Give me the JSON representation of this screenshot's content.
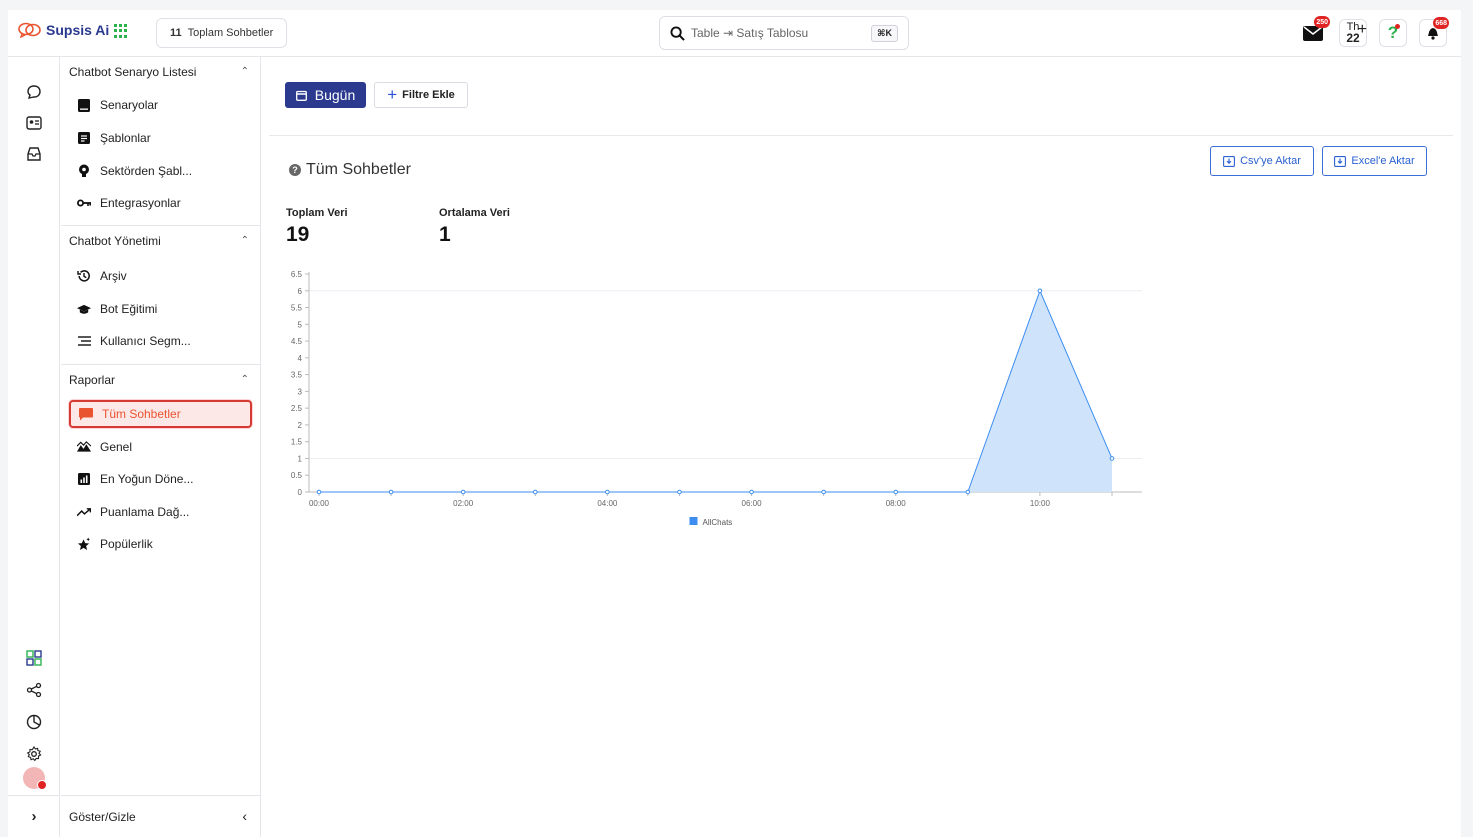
{
  "app": {
    "name": "Supsis Ai"
  },
  "header": {
    "page_tag_count": "11",
    "page_tag_label": "Toplam Sohbetler",
    "search_value": "Table ⇥ Satış Tablosu",
    "search_shortcut": "⌘K",
    "mail_badge": "250",
    "calendar_day_abbr": "Th",
    "calendar_day": "22",
    "notification_badge": "668",
    "colors": {
      "brand": "#2b3a8f",
      "accent_red": "#e02424",
      "link_blue": "#2b61d1"
    }
  },
  "sidebar": {
    "sections": [
      {
        "title": "Chatbot Senaryo Listesi",
        "items": [
          {
            "label": "Senaryolar",
            "icon": "book-icon"
          },
          {
            "label": "Şablonlar",
            "icon": "template-icon"
          },
          {
            "label": "Sektörden Şabl...",
            "icon": "bulb-icon"
          },
          {
            "label": "Entegrasyonlar",
            "icon": "key-icon"
          }
        ]
      },
      {
        "title": "Chatbot Yönetimi",
        "items": [
          {
            "label": "Arşiv",
            "icon": "history-icon"
          },
          {
            "label": "Bot Eğitimi",
            "icon": "graduation-cap-icon"
          },
          {
            "label": "Kullanıcı Segm...",
            "icon": "segment-lines-icon"
          }
        ]
      },
      {
        "title": "Raporlar",
        "items": [
          {
            "label": "Tüm Sohbetler",
            "icon": "chat-bubble-icon",
            "active": true
          },
          {
            "label": "Genel",
            "icon": "mountain-chart-icon"
          },
          {
            "label": "En Yoğun Döne...",
            "icon": "bar-chart-icon"
          },
          {
            "label": "Puanlama Dağ...",
            "icon": "trend-icon"
          },
          {
            "label": "Popülerlik",
            "icon": "stars-icon"
          }
        ]
      }
    ],
    "footer_label": "Göster/Gizle"
  },
  "main": {
    "today_button": "Bugün",
    "filter_button": "Filtre Ekle",
    "title": "Tüm Sohbetler",
    "export_csv": "Csv'ye Aktar",
    "export_excel": "Excel'e Aktar",
    "stats": [
      {
        "label": "Toplam Veri",
        "value": "19"
      },
      {
        "label": "Ortalama Veri",
        "value": "1"
      }
    ]
  },
  "chart_data": {
    "type": "area",
    "x": [
      "00:00",
      "01:00",
      "02:00",
      "03:00",
      "04:00",
      "05:00",
      "06:00",
      "07:00",
      "08:00",
      "09:00",
      "10:00",
      "11:00"
    ],
    "x_tick_labels": [
      "00:00",
      "",
      "02:00",
      "",
      "04:00",
      "",
      "06:00",
      "",
      "08:00",
      "",
      "10:00",
      ""
    ],
    "series": [
      {
        "name": "AllChats",
        "values": [
          0,
          0,
          0,
          0,
          0,
          0,
          0,
          0,
          0,
          0,
          6,
          1
        ],
        "color": "#3d8ef0",
        "fill": "#cfe3fb"
      }
    ],
    "y_ticks": [
      0,
      0.5,
      1,
      1.5,
      2,
      2.5,
      3,
      3.5,
      4,
      4.5,
      5,
      5.5,
      6,
      6.5
    ],
    "ylim": [
      0,
      6.5
    ],
    "legend_position": "bottom-center",
    "grid": "horizontal"
  }
}
